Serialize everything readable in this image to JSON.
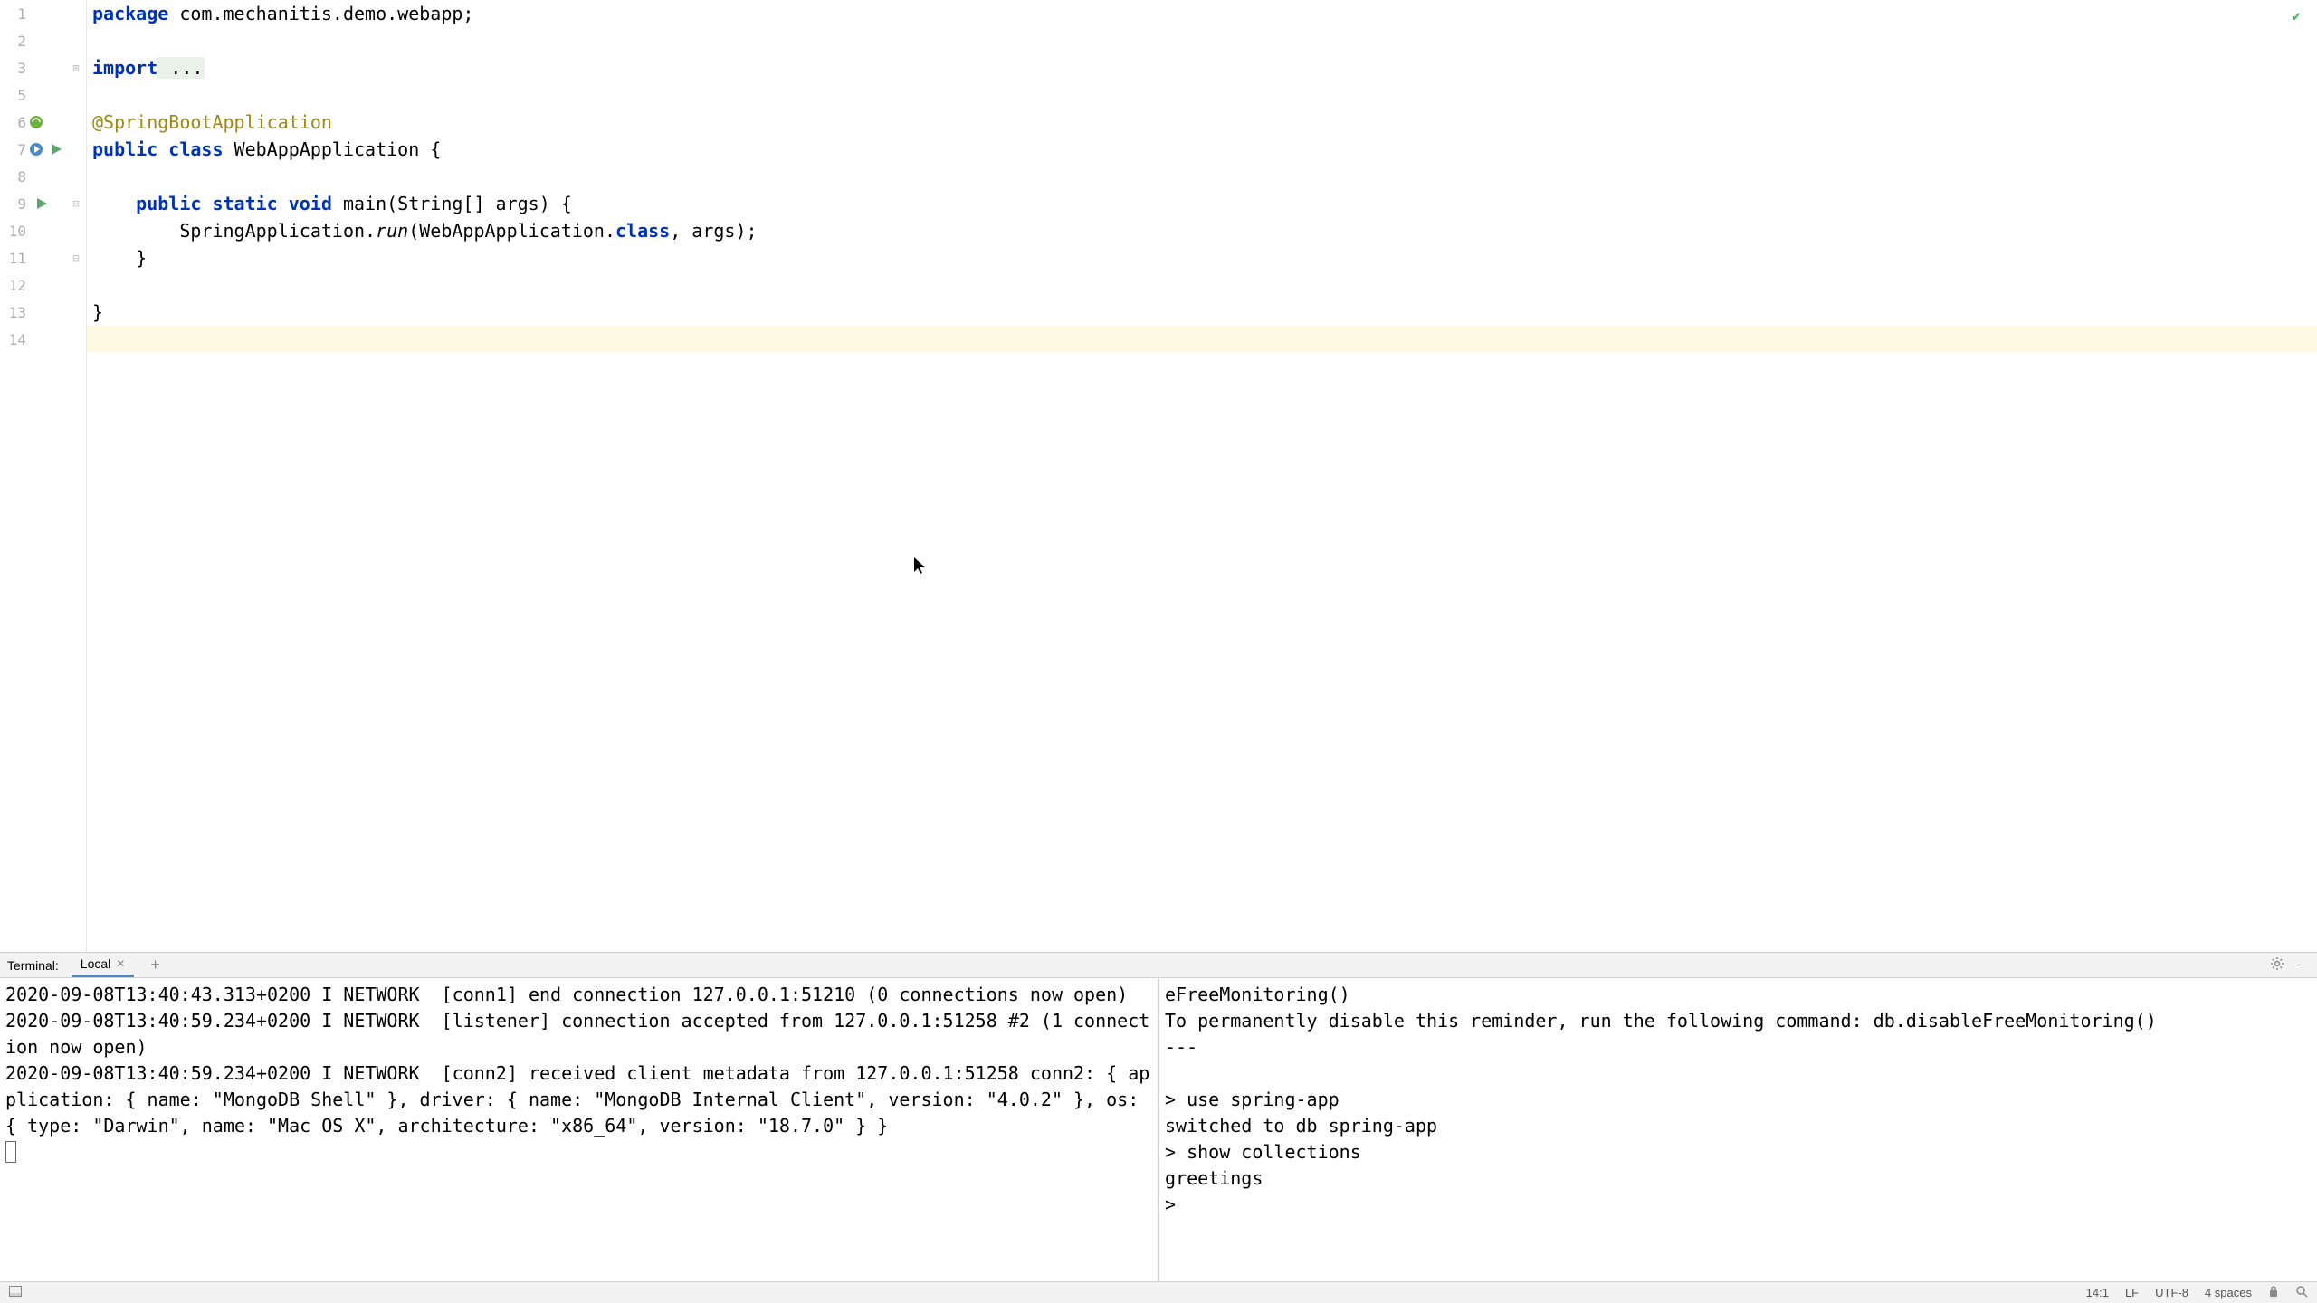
{
  "editor": {
    "line_numbers": [
      "1",
      "2",
      "3",
      "5",
      "6",
      "7",
      "8",
      "9",
      "10",
      "11",
      "12",
      "13",
      "14"
    ],
    "code": {
      "line1": {
        "kw": "package",
        "rest": " com.mechanitis.demo.webapp;"
      },
      "line3": {
        "kw": "import",
        "fold": " ..."
      },
      "line6": {
        "ann": "@SpringBootApplication"
      },
      "line7": {
        "kw1": "public",
        "kw2": " class",
        "rest": " WebAppApplication {"
      },
      "line9": {
        "indent": "    ",
        "kw1": "public",
        "kw2": " static",
        "kw3": " void",
        "rest": " main(String[] args) {"
      },
      "line10": {
        "indent": "        ",
        "pre": "SpringApplication.",
        "method": "run",
        "post": "(WebAppApplication.",
        "kw": "class",
        "post2": ", args);"
      },
      "line11": {
        "text": "    }"
      },
      "line13": {
        "text": "}"
      }
    }
  },
  "terminal": {
    "title": "Terminal:",
    "tab_label": "Local",
    "left_pane": "2020-09-08T13:40:43.313+0200 I NETWORK  [conn1] end connection 127.0.0.1:51210 (0 connections now open)\n2020-09-08T13:40:59.234+0200 I NETWORK  [listener] connection accepted from 127.0.0.1:51258 #2 (1 connection now open)\n2020-09-08T13:40:59.234+0200 I NETWORK  [conn2] received client metadata from 127.0.0.1:51258 conn2: { application: { name: \"MongoDB Shell\" }, driver: { name: \"MongoDB Internal Client\", version: \"4.0.2\" }, os: { type: \"Darwin\", name: \"Mac OS X\", architecture: \"x86_64\", version: \"18.7.0\" } }",
    "right_pane": "eFreeMonitoring()\nTo permanently disable this reminder, run the following command: db.disableFreeMonitoring()\n---\n\n> use spring-app\nswitched to db spring-app\n> show collections\ngreetings\n> "
  },
  "status": {
    "position": "14:1",
    "line_sep": "LF",
    "encoding": "UTF-8",
    "indent": "4 spaces"
  }
}
